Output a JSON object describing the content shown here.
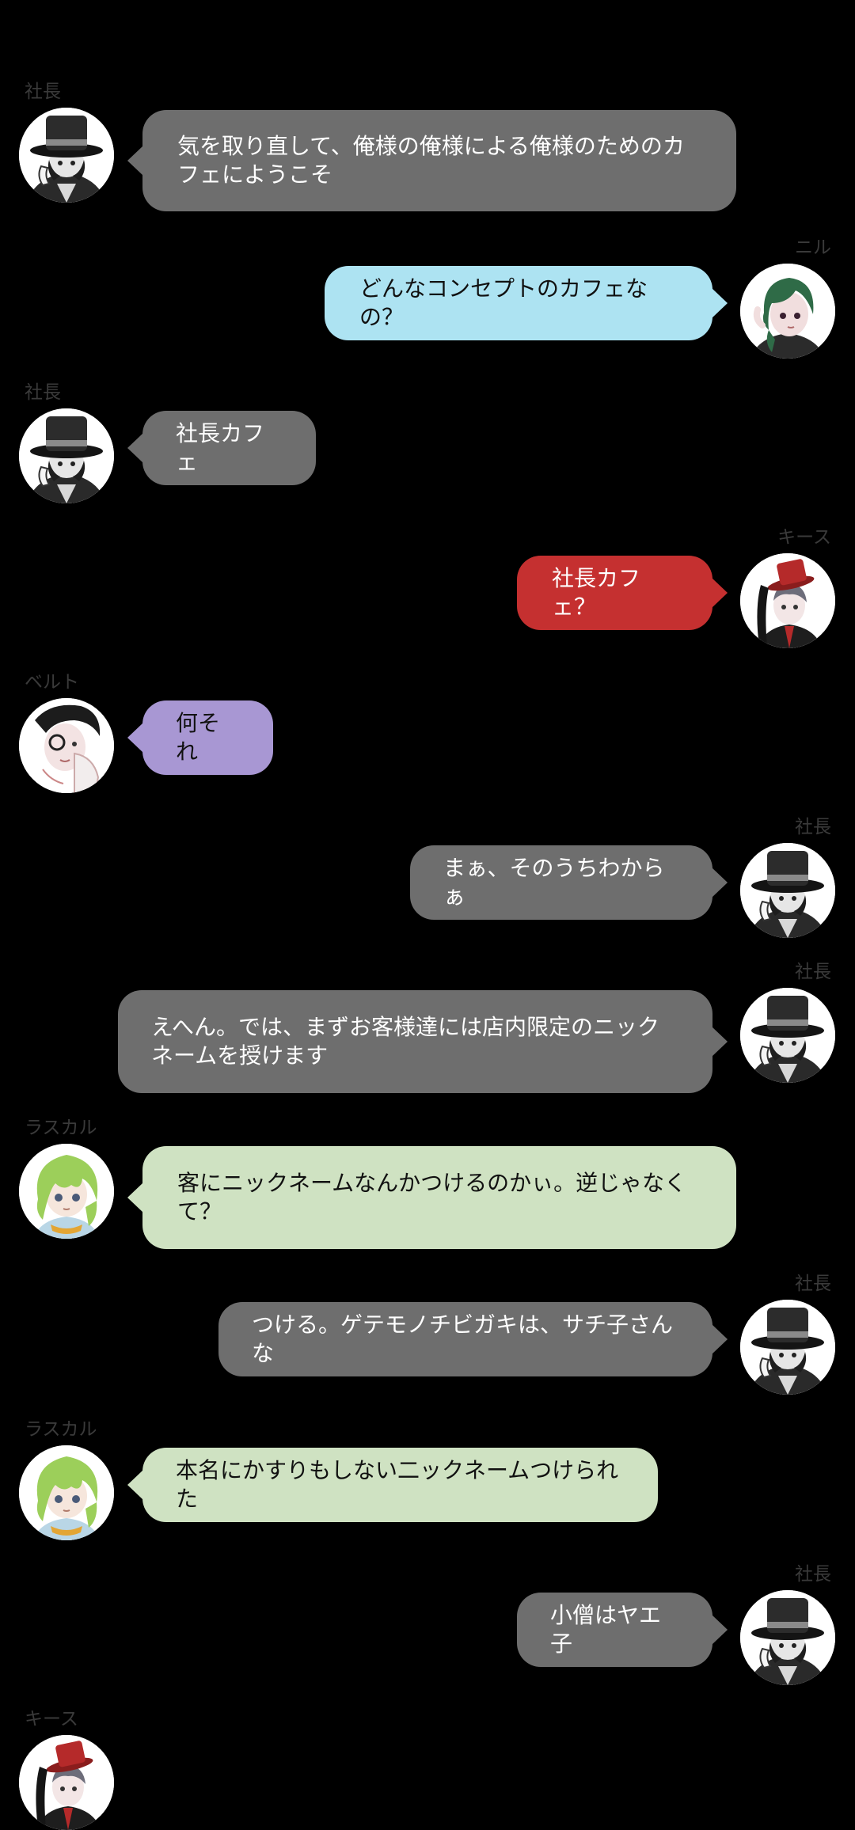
{
  "colors": {
    "background": "#000000",
    "name_label": "#3a3a3a",
    "bubble_boss": "#6e6e6e",
    "bubble_nil": "#ade3f2",
    "bubble_keith": "#c53030",
    "bubble_belt": "#a897d3",
    "bubble_rascal": "#cfe2c2"
  },
  "messages": [
    {
      "speaker": "社長",
      "avatar": "top-hat-boss-avatar",
      "text": "気を取り直して、俺様の俺様による俺様のためのカ\nフェにようこそ"
    },
    {
      "speaker": "ニル",
      "avatar": "green-hair-nil-avatar",
      "text": "どんなコンセプトのカフェなの？"
    },
    {
      "speaker": "社長",
      "avatar": "top-hat-boss-avatar",
      "text": "社長カフェ"
    },
    {
      "speaker": "キース",
      "avatar": "red-hat-keith-avatar",
      "text": "社長カフェ？"
    },
    {
      "speaker": "ベルト",
      "avatar": "monocle-belt-avatar",
      "text": "何それ"
    },
    {
      "speaker": "社長",
      "avatar": "top-hat-boss-avatar",
      "text": "まぁ、そのうちわからぁ"
    },
    {
      "speaker": "社長",
      "avatar": "top-hat-boss-avatar",
      "text": "えへん。では、まずお客様達には店内限定のニック\nネームを授けます"
    },
    {
      "speaker": "ラスカル",
      "avatar": "green-hair-rascal-avatar",
      "text": "客にニックネームなんかつけるのかぃ。逆じゃなく\nて？"
    },
    {
      "speaker": "社長",
      "avatar": "top-hat-boss-avatar",
      "text": "つける。ゲテモノチビガキは、サチ子さんな"
    },
    {
      "speaker": "ラスカル",
      "avatar": "green-hair-rascal-avatar",
      "text": "本名にかすりもしない二ックネームつけられた"
    },
    {
      "speaker": "社長",
      "avatar": "top-hat-boss-avatar",
      "text": "小僧はヤエ子"
    },
    {
      "speaker": "キース",
      "avatar": "red-hat-keith-avatar",
      "text": ""
    }
  ]
}
